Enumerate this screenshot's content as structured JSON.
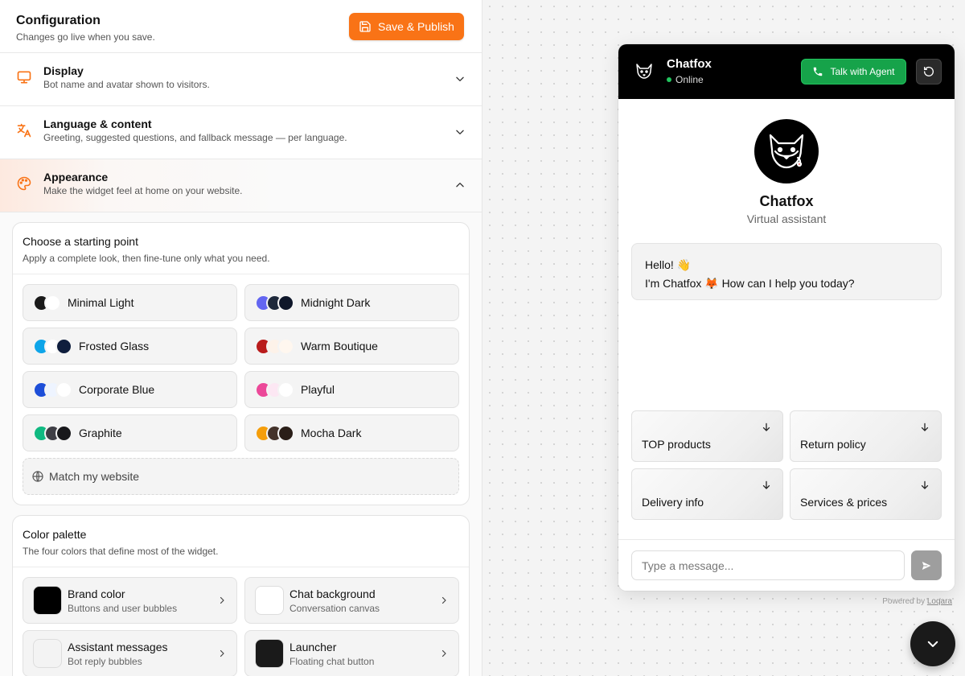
{
  "config": {
    "title": "Configuration",
    "subtitle": "Changes go live when you save.",
    "save_label": "Save & Publish",
    "accent": "#f97316"
  },
  "sections": [
    {
      "title": "Display",
      "subtitle": "Bot name and avatar shown to visitors.",
      "icon": "monitor-icon",
      "expanded": false
    },
    {
      "title": "Language & content",
      "subtitle": "Greeting, suggested questions, and fallback message — per language.",
      "icon": "translate-icon",
      "expanded": false
    },
    {
      "title": "Appearance",
      "subtitle": "Make the widget feel at home on your website.",
      "icon": "palette-icon",
      "expanded": true
    }
  ],
  "starting_point": {
    "title": "Choose a starting point",
    "subtitle": "Apply a complete look, then fine-tune only what you need.",
    "presets": [
      {
        "label": "Minimal Light",
        "colors": [
          "#1a1a1a",
          "#ffffff"
        ]
      },
      {
        "label": "Midnight Dark",
        "colors": [
          "#6366f1",
          "#1e293b",
          "#0f172a"
        ]
      },
      {
        "label": "Frosted Glass",
        "colors": [
          "#0ea5e9",
          "#ffffff",
          "#0f1e3d"
        ]
      },
      {
        "label": "Warm Boutique",
        "colors": [
          "#b91c1c",
          "#fdf2e9",
          "#fff7ef"
        ]
      },
      {
        "label": "Corporate Blue",
        "colors": [
          "#1d4ed8",
          "#eef4ff",
          "#ffffff"
        ]
      },
      {
        "label": "Playful",
        "colors": [
          "#ec4899",
          "#fce7f3",
          "#ffffff"
        ]
      },
      {
        "label": "Graphite",
        "colors": [
          "#10b981",
          "#3f3f46",
          "#18181b"
        ]
      },
      {
        "label": "Mocha Dark",
        "colors": [
          "#f59e0b",
          "#44332b",
          "#2a1e18"
        ]
      }
    ],
    "match_label": "Match my website"
  },
  "palette": {
    "title": "Color palette",
    "subtitle": "The four colors that define most of the widget.",
    "items": [
      {
        "title": "Brand color",
        "subtitle": "Buttons and user bubbles",
        "color": "#000000"
      },
      {
        "title": "Chat background",
        "subtitle": "Conversation canvas",
        "color": "#ffffff"
      },
      {
        "title": "Assistant messages",
        "subtitle": "Bot reply bubbles",
        "color": "#f3f3f3"
      },
      {
        "title": "Launcher",
        "subtitle": "Floating chat button",
        "color": "#1a1a1a"
      }
    ]
  },
  "widget": {
    "bot_name": "Chatfox",
    "status": "Online",
    "agent_button": "Talk with Agent",
    "role": "Virtual assistant",
    "greeting_line1": "Hello! 👋",
    "greeting_line2": "I'm Chatfox 🦊 How can I help you today?",
    "suggestions": [
      "TOP products",
      "Return policy",
      "Delivery info",
      "Services & prices"
    ],
    "input_placeholder": "Type a message...",
    "powered_prefix": "Powered by",
    "powered_brand": "Loqara"
  }
}
